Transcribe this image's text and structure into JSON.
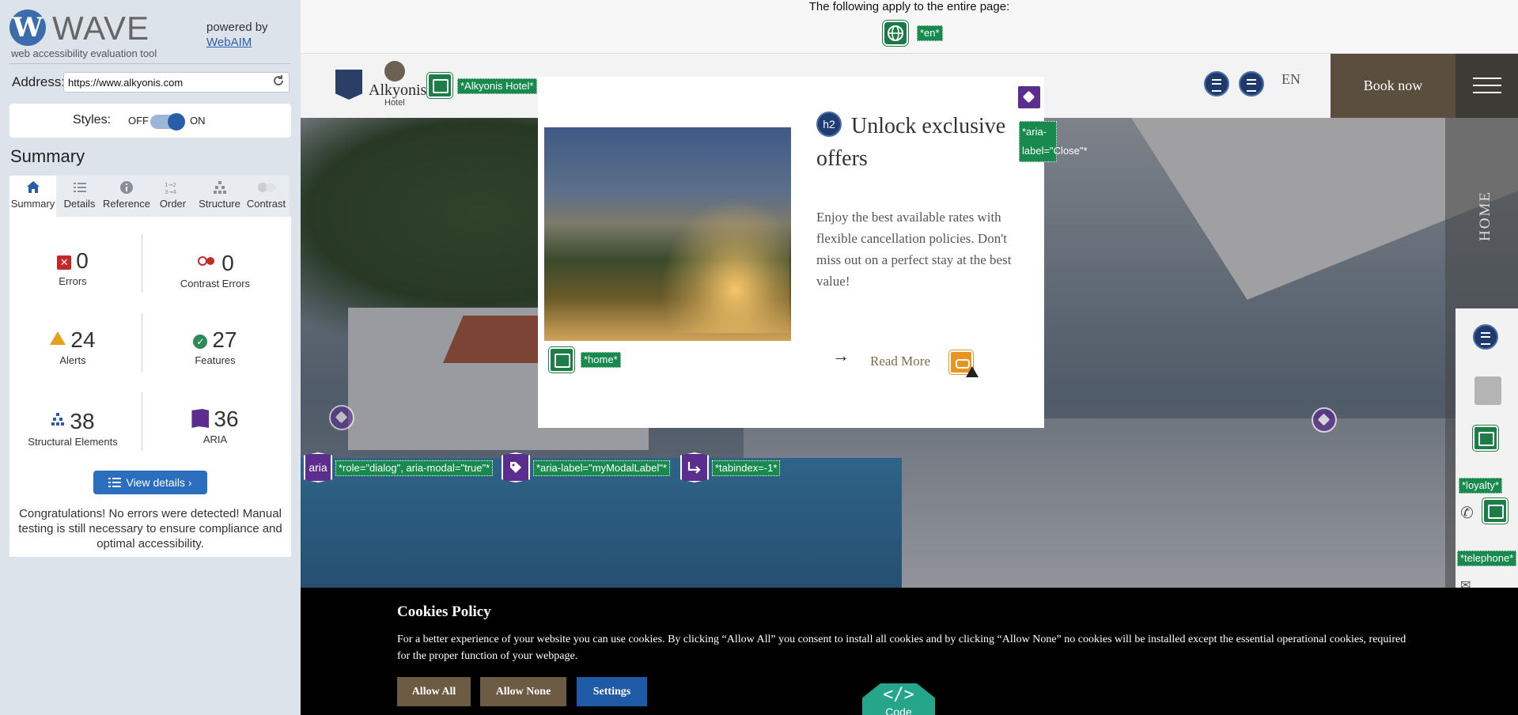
{
  "wave": {
    "logo_letter": "W",
    "logo_name": "WAVE",
    "tagline": "web accessibility evaluation tool",
    "powered_by": "powered by",
    "powered_link": "WebAIM",
    "address_label": "Address:",
    "address_value": "https://www.alkyonis.com",
    "styles_label": "Styles:",
    "styles_off": "OFF",
    "styles_on": "ON",
    "summary_heading": "Summary",
    "tabs": [
      {
        "label": "Summary",
        "icon": "home-icon",
        "active": true
      },
      {
        "label": "Details",
        "icon": "list-icon",
        "active": false
      },
      {
        "label": "Reference",
        "icon": "info-icon",
        "active": false
      },
      {
        "label": "Order",
        "icon": "order-icon",
        "active": false
      },
      {
        "label": "Structure",
        "icon": "structure-icon",
        "active": false
      },
      {
        "label": "Contrast",
        "icon": "contrast-icon",
        "active": false
      }
    ],
    "stats": {
      "errors": {
        "value": "0",
        "label": "Errors"
      },
      "contrast_errors": {
        "value": "0",
        "label": "Contrast Errors"
      },
      "alerts": {
        "value": "24",
        "label": "Alerts"
      },
      "features": {
        "value": "27",
        "label": "Features"
      },
      "structural": {
        "value": "38",
        "label": "Structural Elements"
      },
      "aria": {
        "value": "36",
        "label": "ARIA"
      }
    },
    "view_details": "View details ›",
    "congrats": "Congratulations! No errors were detected! Manual testing is still necessary to ensure compliance and optimal accessibility."
  },
  "page": {
    "notice_text": "The following apply to the entire page:",
    "lang_tag": "*en*",
    "logo_name": "Alkyonis",
    "logo_sub": "Hotel",
    "logo_alt_tag": "*Alkyonis Hotel*",
    "lang_switch": "EN",
    "book_now": "Book now",
    "side_home": "HOME",
    "modal": {
      "heading_badge": "h2",
      "title": "Unlock exclusive offers",
      "text": "Enjoy the best available rates with flexible cancellation policies. Don't miss out on a perfect stay at the best value!",
      "read_more": "Read More",
      "image_alt_tag": "*home*",
      "close_label_tag": "*aria-label=\"Close\"*"
    },
    "aria_row": {
      "aria_badge": "aria",
      "role_tag": "*role=\"dialog\", aria-modal=\"true\"*",
      "label_tag": "*aria-label=\"myModalLabel\"*",
      "tabindex_tag": "*tabindex=-1*"
    },
    "side_tags": {
      "loyalty": "*loyalty*",
      "telephone": "*telephone*"
    },
    "cookies": {
      "title": "Cookies Policy",
      "text": "For a better experience of your website you can use cookies. By clicking “Allow All” you consent to install all cookies and by clicking “Allow None” no cookies will be installed except the essential operational cookies, required for the proper function of your webpage.",
      "allow_all": "Allow All",
      "allow_none": "Allow None",
      "settings": "Settings"
    },
    "code_button": {
      "glyph": "</>",
      "label": "Code"
    }
  },
  "colors": {
    "wave_blue": "#2a5da8",
    "feature_green": "#188a4e",
    "aria_purple": "#5b2d8e",
    "alert_orange": "#e6a020",
    "error_red": "#c62828",
    "book_now_brown": "#5b4e3e",
    "settings_blue": "#1f5aa6"
  }
}
